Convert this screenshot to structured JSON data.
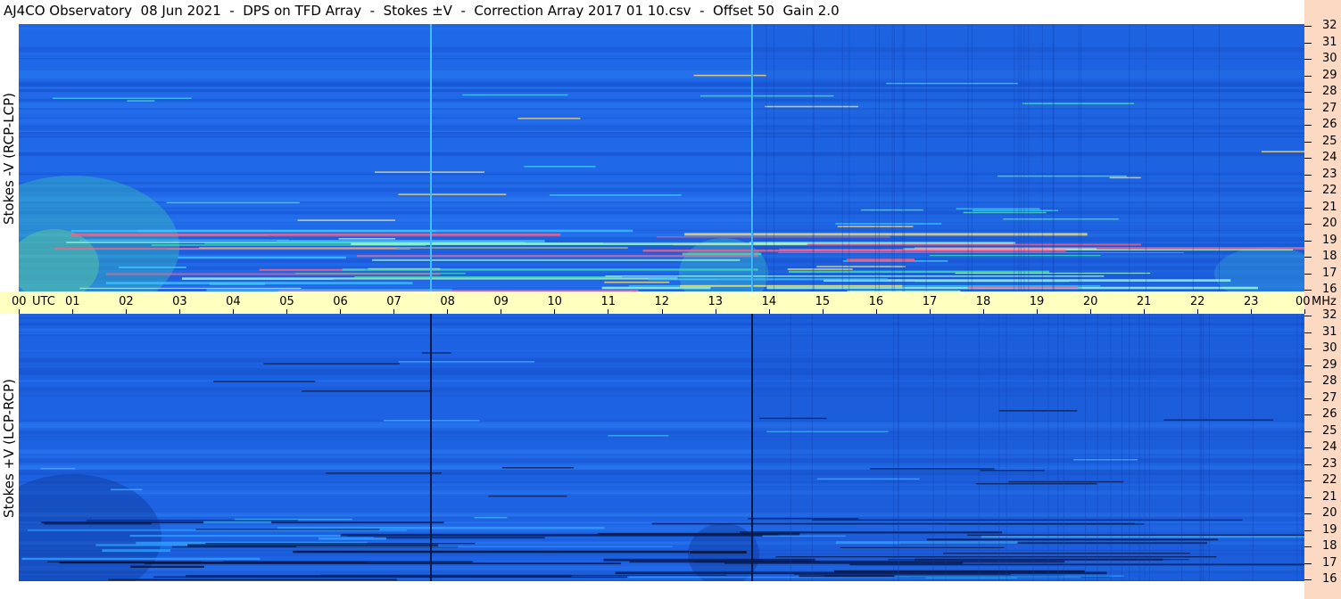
{
  "title": "AJ4CO Observatory  08 Jun 2021  -  DPS on TFD Array  -  Stokes ±V  -  Correction Array 2017 01 10.csv  -  Offset 50  Gain 2.0",
  "chart_data": {
    "type": "heatmap",
    "title": "AJ4CO Observatory  08 Jun 2021  -  DPS on TFD Array  -  Stokes ±V  -  Correction Array 2017 01 10.csv  -  Offset 50  Gain 2.0",
    "panels": [
      {
        "ylabel": "Stokes -V (RCP-LCP)",
        "ylim": [
          16,
          32
        ]
      },
      {
        "ylabel": "Stokes +V (LCP-RCP)",
        "ylim": [
          16,
          32
        ]
      }
    ],
    "x_ticks": [
      "00",
      "01",
      "02",
      "03",
      "04",
      "05",
      "06",
      "07",
      "08",
      "09",
      "10",
      "11",
      "12",
      "13",
      "14",
      "15",
      "16",
      "17",
      "18",
      "19",
      "20",
      "21",
      "22",
      "23",
      "00"
    ],
    "x_unit_label": "UTC",
    "y_ticks": [
      "32",
      "31",
      "30",
      "29",
      "28",
      "27",
      "26",
      "25",
      "24",
      "23",
      "22",
      "21",
      "20",
      "19",
      "18",
      "17",
      "16"
    ],
    "y_unit_label": "MHz",
    "xlim": [
      0,
      24
    ],
    "colors": {
      "background": "#1e64e6",
      "bright": "#30d0a0",
      "dark": "#081838",
      "axis_band": "#ffffc0",
      "right_strip": "#fcd9c2"
    }
  }
}
